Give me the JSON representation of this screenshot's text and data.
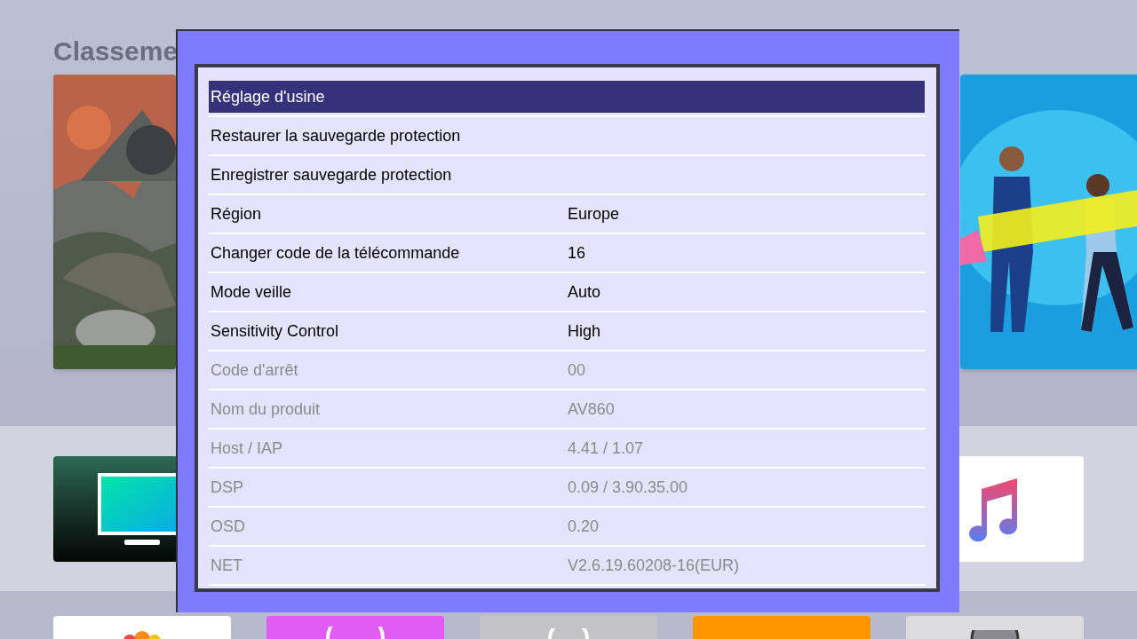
{
  "background": {
    "heading": "Classeme"
  },
  "menu": {
    "rows": [
      {
        "label": "Réglage d'usine",
        "selected": true,
        "disabled": false
      },
      {
        "label": "Restaurer la sauvegarde protection",
        "selected": false,
        "disabled": false
      },
      {
        "label": "Enregistrer sauvegarde protection",
        "selected": false,
        "disabled": false
      },
      {
        "label": "Région",
        "value": "Europe",
        "selected": false,
        "disabled": false
      },
      {
        "label": "Changer code de la télécommande",
        "value": "16",
        "selected": false,
        "disabled": false
      },
      {
        "label": "Mode veille",
        "value": "Auto",
        "selected": false,
        "disabled": false
      },
      {
        "label": "Sensitivity Control",
        "value": "High",
        "selected": false,
        "disabled": false
      },
      {
        "label": "Code d'arrêt",
        "value": "00",
        "selected": false,
        "disabled": true
      },
      {
        "label": "Nom du produit",
        "value": "AV860",
        "selected": false,
        "disabled": true
      },
      {
        "label": "Host / IAP",
        "value": "4.41 / 1.07",
        "selected": false,
        "disabled": true
      },
      {
        "label": "DSP",
        "value": "0.09 / 3.90.35.00",
        "selected": false,
        "disabled": true
      },
      {
        "label": "OSD",
        "value": "0.20",
        "selected": false,
        "disabled": true
      },
      {
        "label": "NET",
        "value": "V2.6.19.60208-16(EUR)",
        "selected": false,
        "disabled": true
      }
    ]
  }
}
